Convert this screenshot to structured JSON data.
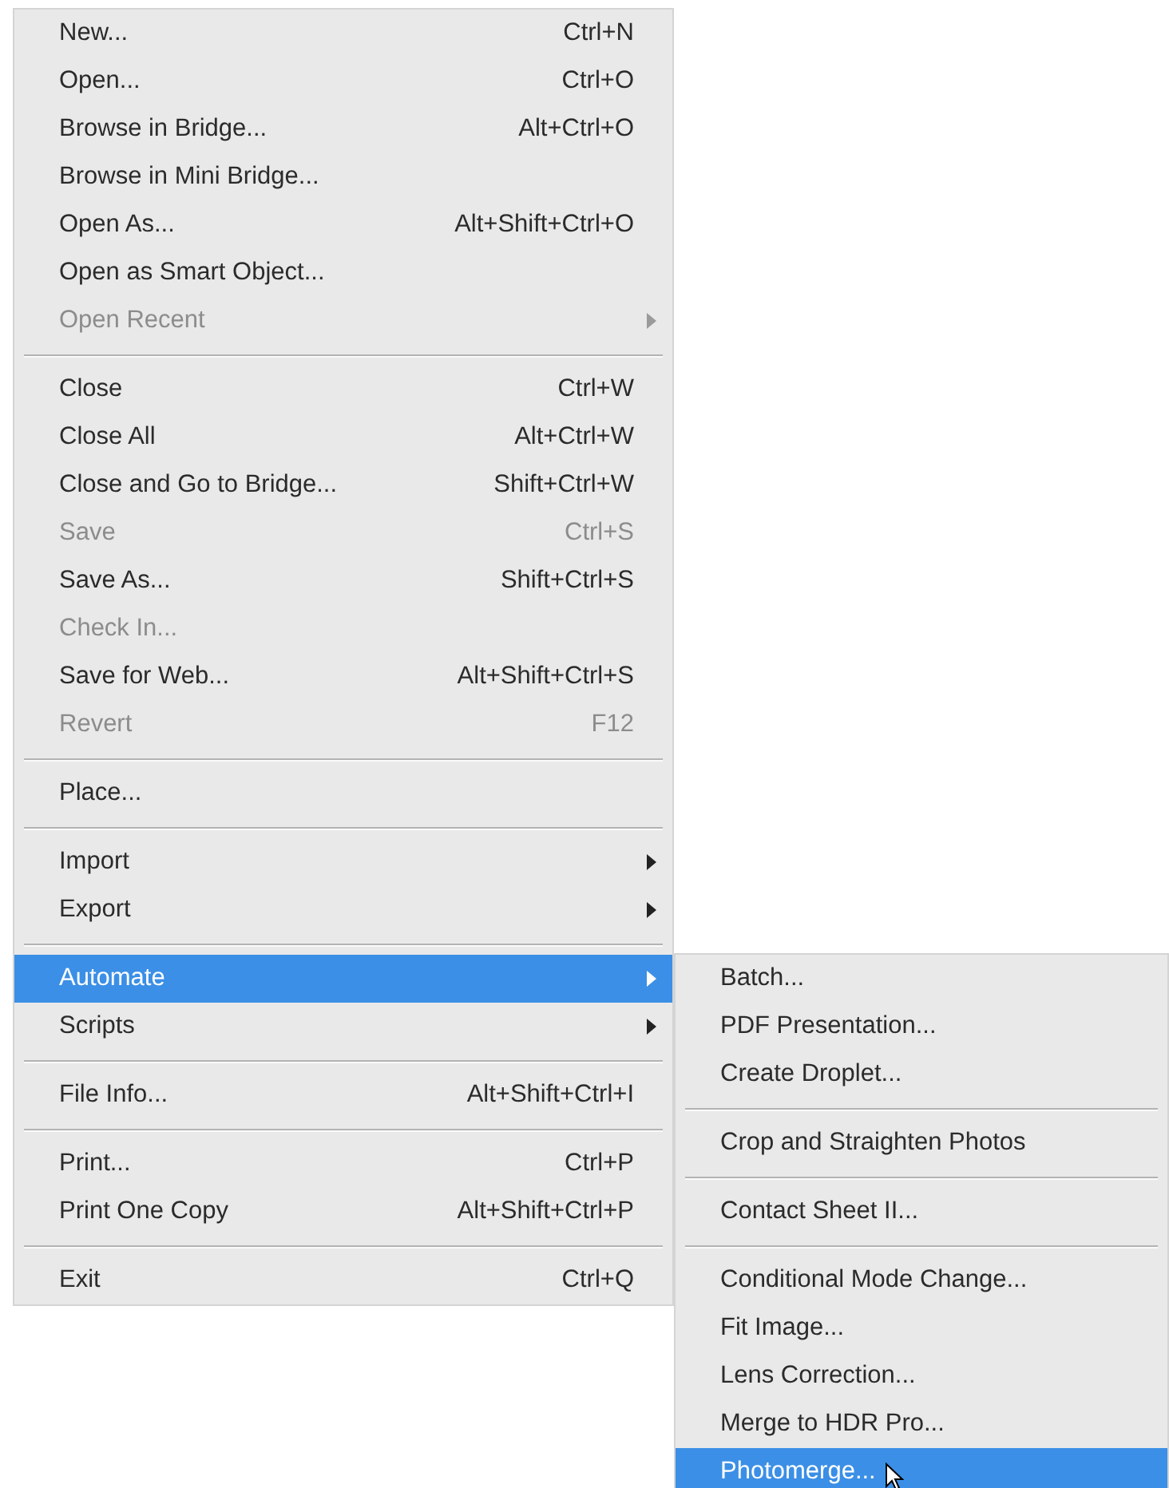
{
  "file_menu": {
    "items": [
      {
        "kind": "item",
        "label": "New...",
        "shortcut": "Ctrl+N",
        "disabled": false,
        "selected": false,
        "has_submenu": false
      },
      {
        "kind": "item",
        "label": "Open...",
        "shortcut": "Ctrl+O",
        "disabled": false,
        "selected": false,
        "has_submenu": false
      },
      {
        "kind": "item",
        "label": "Browse in Bridge...",
        "shortcut": "Alt+Ctrl+O",
        "disabled": false,
        "selected": false,
        "has_submenu": false
      },
      {
        "kind": "item",
        "label": "Browse in Mini Bridge...",
        "disabled": false,
        "selected": false,
        "has_submenu": false
      },
      {
        "kind": "item",
        "label": "Open As...",
        "shortcut": "Alt+Shift+Ctrl+O",
        "disabled": false,
        "selected": false,
        "has_submenu": false
      },
      {
        "kind": "item",
        "label": "Open as Smart Object...",
        "disabled": false,
        "selected": false,
        "has_submenu": false
      },
      {
        "kind": "item",
        "label": "Open Recent",
        "disabled": true,
        "selected": false,
        "has_submenu": true
      },
      {
        "kind": "separator"
      },
      {
        "kind": "item",
        "label": "Close",
        "shortcut": "Ctrl+W",
        "disabled": false,
        "selected": false,
        "has_submenu": false
      },
      {
        "kind": "item",
        "label": "Close All",
        "shortcut": "Alt+Ctrl+W",
        "disabled": false,
        "selected": false,
        "has_submenu": false
      },
      {
        "kind": "item",
        "label": "Close and Go to Bridge...",
        "shortcut": "Shift+Ctrl+W",
        "disabled": false,
        "selected": false,
        "has_submenu": false
      },
      {
        "kind": "item",
        "label": "Save",
        "shortcut": "Ctrl+S",
        "disabled": true,
        "selected": false,
        "has_submenu": false
      },
      {
        "kind": "item",
        "label": "Save As...",
        "shortcut": "Shift+Ctrl+S",
        "disabled": false,
        "selected": false,
        "has_submenu": false
      },
      {
        "kind": "item",
        "label": "Check In...",
        "disabled": true,
        "selected": false,
        "has_submenu": false
      },
      {
        "kind": "item",
        "label": "Save for Web...",
        "shortcut": "Alt+Shift+Ctrl+S",
        "disabled": false,
        "selected": false,
        "has_submenu": false
      },
      {
        "kind": "item",
        "label": "Revert",
        "shortcut": "F12",
        "disabled": true,
        "selected": false,
        "has_submenu": false
      },
      {
        "kind": "separator"
      },
      {
        "kind": "item",
        "label": "Place...",
        "disabled": false,
        "selected": false,
        "has_submenu": false
      },
      {
        "kind": "separator"
      },
      {
        "kind": "item",
        "label": "Import",
        "disabled": false,
        "selected": false,
        "has_submenu": true
      },
      {
        "kind": "item",
        "label": "Export",
        "disabled": false,
        "selected": false,
        "has_submenu": true
      },
      {
        "kind": "separator"
      },
      {
        "kind": "item",
        "label": "Automate",
        "disabled": false,
        "selected": true,
        "has_submenu": true
      },
      {
        "kind": "item",
        "label": "Scripts",
        "disabled": false,
        "selected": false,
        "has_submenu": true
      },
      {
        "kind": "separator"
      },
      {
        "kind": "item",
        "label": "File Info...",
        "shortcut": "Alt+Shift+Ctrl+I",
        "disabled": false,
        "selected": false,
        "has_submenu": false
      },
      {
        "kind": "separator"
      },
      {
        "kind": "item",
        "label": "Print...",
        "shortcut": "Ctrl+P",
        "disabled": false,
        "selected": false,
        "has_submenu": false
      },
      {
        "kind": "item",
        "label": "Print One Copy",
        "shortcut": "Alt+Shift+Ctrl+P",
        "disabled": false,
        "selected": false,
        "has_submenu": false
      },
      {
        "kind": "separator"
      },
      {
        "kind": "item",
        "label": "Exit",
        "shortcut": "Ctrl+Q",
        "disabled": false,
        "selected": false,
        "has_submenu": false
      }
    ]
  },
  "automate_submenu": {
    "items": [
      {
        "kind": "item",
        "label": "Batch...",
        "disabled": false,
        "selected": false,
        "has_submenu": false
      },
      {
        "kind": "item",
        "label": "PDF Presentation...",
        "disabled": false,
        "selected": false,
        "has_submenu": false
      },
      {
        "kind": "item",
        "label": "Create Droplet...",
        "disabled": false,
        "selected": false,
        "has_submenu": false
      },
      {
        "kind": "separator"
      },
      {
        "kind": "item",
        "label": "Crop and Straighten Photos",
        "disabled": false,
        "selected": false,
        "has_submenu": false
      },
      {
        "kind": "separator"
      },
      {
        "kind": "item",
        "label": "Contact Sheet II...",
        "disabled": false,
        "selected": false,
        "has_submenu": false
      },
      {
        "kind": "separator"
      },
      {
        "kind": "item",
        "label": "Conditional Mode Change...",
        "disabled": false,
        "selected": false,
        "has_submenu": false
      },
      {
        "kind": "item",
        "label": "Fit Image...",
        "disabled": false,
        "selected": false,
        "has_submenu": false
      },
      {
        "kind": "item",
        "label": "Lens Correction...",
        "disabled": false,
        "selected": false,
        "has_submenu": false
      },
      {
        "kind": "item",
        "label": "Merge to HDR Pro...",
        "disabled": false,
        "selected": false,
        "has_submenu": false
      },
      {
        "kind": "item",
        "label": "Photomerge...",
        "disabled": false,
        "selected": true,
        "has_submenu": false
      }
    ]
  }
}
